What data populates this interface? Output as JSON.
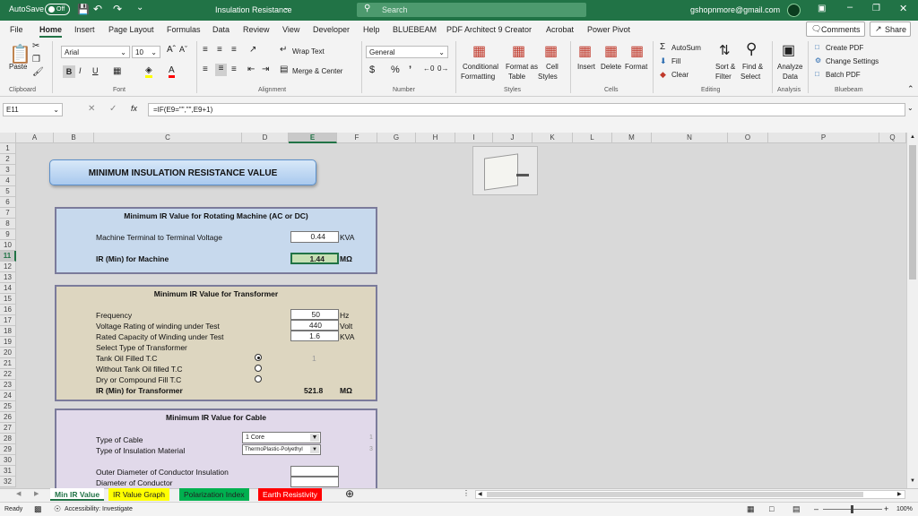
{
  "titlebar": {
    "autosave": "AutoSave",
    "autosave_state": "Off",
    "filename": "Insulation Resistance",
    "search_placeholder": "Search",
    "user": "gshopnmore@gmail.com"
  },
  "tabs": [
    "File",
    "Home",
    "Insert",
    "Page Layout",
    "Formulas",
    "Data",
    "Review",
    "View",
    "Developer",
    "Help",
    "BLUEBEAM",
    "PDF Architect 9 Creator",
    "Acrobat",
    "Power Pivot"
  ],
  "tab_active": "Home",
  "header_buttons": {
    "comments": "Comments",
    "share": "Share"
  },
  "ribbon": {
    "paste": "Paste",
    "clipboard": "Clipboard",
    "font_name": "Arial",
    "font_size": "10",
    "font_group": "Font",
    "wrap_text": "Wrap Text",
    "merge_center": "Merge & Center",
    "alignment_group": "Alignment",
    "number_format": "General",
    "number_group": "Number",
    "conditional": "Conditional",
    "formatting": "Formatting",
    "format_as": "Format as",
    "table": "Table",
    "cell": "Cell",
    "styles_btn": "Styles",
    "styles_group": "Styles",
    "insert": "Insert",
    "delete": "Delete",
    "format": "Format",
    "cells_group": "Cells",
    "autosum": "AutoSum",
    "fill": "Fill",
    "clear": "Clear",
    "sort_filter": "Sort &",
    "filter": "Filter",
    "find_select": "Find &",
    "select": "Select",
    "editing_group": "Editing",
    "analyze": "Analyze",
    "data": "Data",
    "analysis_group": "Analysis",
    "create_pdf": "Create PDF",
    "change_settings": "Change Settings",
    "batch_pdf": "Batch PDF",
    "bluebeam_group": "Bluebeam"
  },
  "formula": {
    "namebox": "E11",
    "fx": "fx",
    "content": "=IF(E9=\"\",\"\",E9+1)"
  },
  "columns": [
    "A",
    "B",
    "C",
    "D",
    "E",
    "F",
    "G",
    "H",
    "I",
    "J",
    "K",
    "L",
    "M",
    "N",
    "O",
    "P",
    "Q"
  ],
  "rows": [
    "1",
    "2",
    "3",
    "4",
    "5",
    "6",
    "7",
    "8",
    "9",
    "10",
    "11",
    "12",
    "13",
    "14",
    "15",
    "16",
    "17",
    "18",
    "19",
    "20",
    "21",
    "22",
    "23",
    "24",
    "25",
    "26",
    "27",
    "28",
    "29",
    "30",
    "31",
    "32"
  ],
  "sheet": {
    "title": "MINIMUM INSULATION RESISTANCE  VALUE",
    "machine": {
      "heading": "Minimum IR Value for Rotating Machine (AC or DC)",
      "voltage_label": "Machine Terminal to Terminal Voltage",
      "voltage_value": "0.44",
      "voltage_unit": "KVA",
      "ir_label": "IR (Min) for Machine",
      "ir_value": "1.44",
      "ir_unit": "MΩ"
    },
    "transformer": {
      "heading": "Minimum IR Value for Transformer",
      "freq_label": "Frequency",
      "freq_value": "50",
      "freq_unit": "Hz",
      "volt_label": "Voltage Rating of winding under Test",
      "volt_value": "440",
      "volt_unit": "Volt",
      "cap_label": "Rated Capacity of Winding under Test",
      "cap_value": "1.6",
      "cap_unit": "KVA",
      "select_label": "Select Type of Transformer",
      "opt1": "Tank Oil Filled T.C",
      "opt2": "Without Tank Oil filled T.C",
      "opt3": "Dry or Compound Fill T.C",
      "selected_index": "1",
      "ir_label": "IR (Min) for Transformer",
      "ir_value": "521.8",
      "ir_unit": "MΩ"
    },
    "cable": {
      "heading": "Minimum IR Value for Cable",
      "type_label": "Type of Cable",
      "type_value": "1 Core",
      "type_index": "1",
      "insul_label": "Type of Insulation Material",
      "insul_value": "ThermoPlastic-Polyethyl",
      "insul_index": "3",
      "outer_label": "Outer Diameter of Conductor Insulation",
      "diam_label": "Diameter of Conductor"
    }
  },
  "sheet_tabs": [
    {
      "label": "Min IR Value",
      "color": "#ffffff"
    },
    {
      "label": "IR Value Graph",
      "color": "#ffff00"
    },
    {
      "label": "Polarization Index",
      "color": "#00b050"
    },
    {
      "label": "Earth Resistivity",
      "color": "#ff0000"
    }
  ],
  "status": {
    "ready": "Ready",
    "accessibility": "Accessibility: Investigate",
    "zoom": "100%"
  }
}
